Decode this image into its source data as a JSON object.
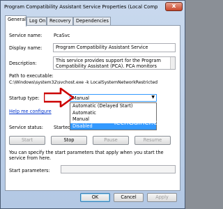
{
  "window": {
    "title": "Program Compatibility Assistant Service Properties (Local Compu...",
    "close_label": "x"
  },
  "tabs": [
    {
      "label": "General"
    },
    {
      "label": "Log On"
    },
    {
      "label": "Recovery"
    },
    {
      "label": "Dependencies"
    }
  ],
  "general": {
    "service_name_label": "Service name:",
    "service_name": "PcaSvc",
    "display_name_label": "Display name:",
    "display_name": "Program Compatibility Assistant Service",
    "description_label": "Description:",
    "description": "This service provides support for the Program Compatibility Assistant (PCA). PCA monitors",
    "path_label": "Path to executable:",
    "path": "C:\\Windows\\system32\\svchost.exe -k LocalSystemNetworkRestricted",
    "startup_label": "Startup type:",
    "startup_value": "Manual",
    "startup_options": [
      "Automatic (Delayed Start)",
      "Automatic",
      "Manual",
      "Disabled"
    ],
    "help_link": "Help me configure",
    "status_label": "Service status:",
    "status_value": "Started",
    "start_button": "Start",
    "stop_button": "Stop",
    "pause_button": "Pause",
    "resume_button": "Resume",
    "params_help": "You can specify the start parameters that apply when you start the service from here.",
    "params_label": "Start parameters:",
    "params_value": ""
  },
  "footer": {
    "ok": "OK",
    "cancel": "Cancel",
    "apply": "Apply"
  },
  "watermark": "TechGainer.com",
  "colors": {
    "accent": "#3399ff",
    "arrow": "#cc0000"
  }
}
